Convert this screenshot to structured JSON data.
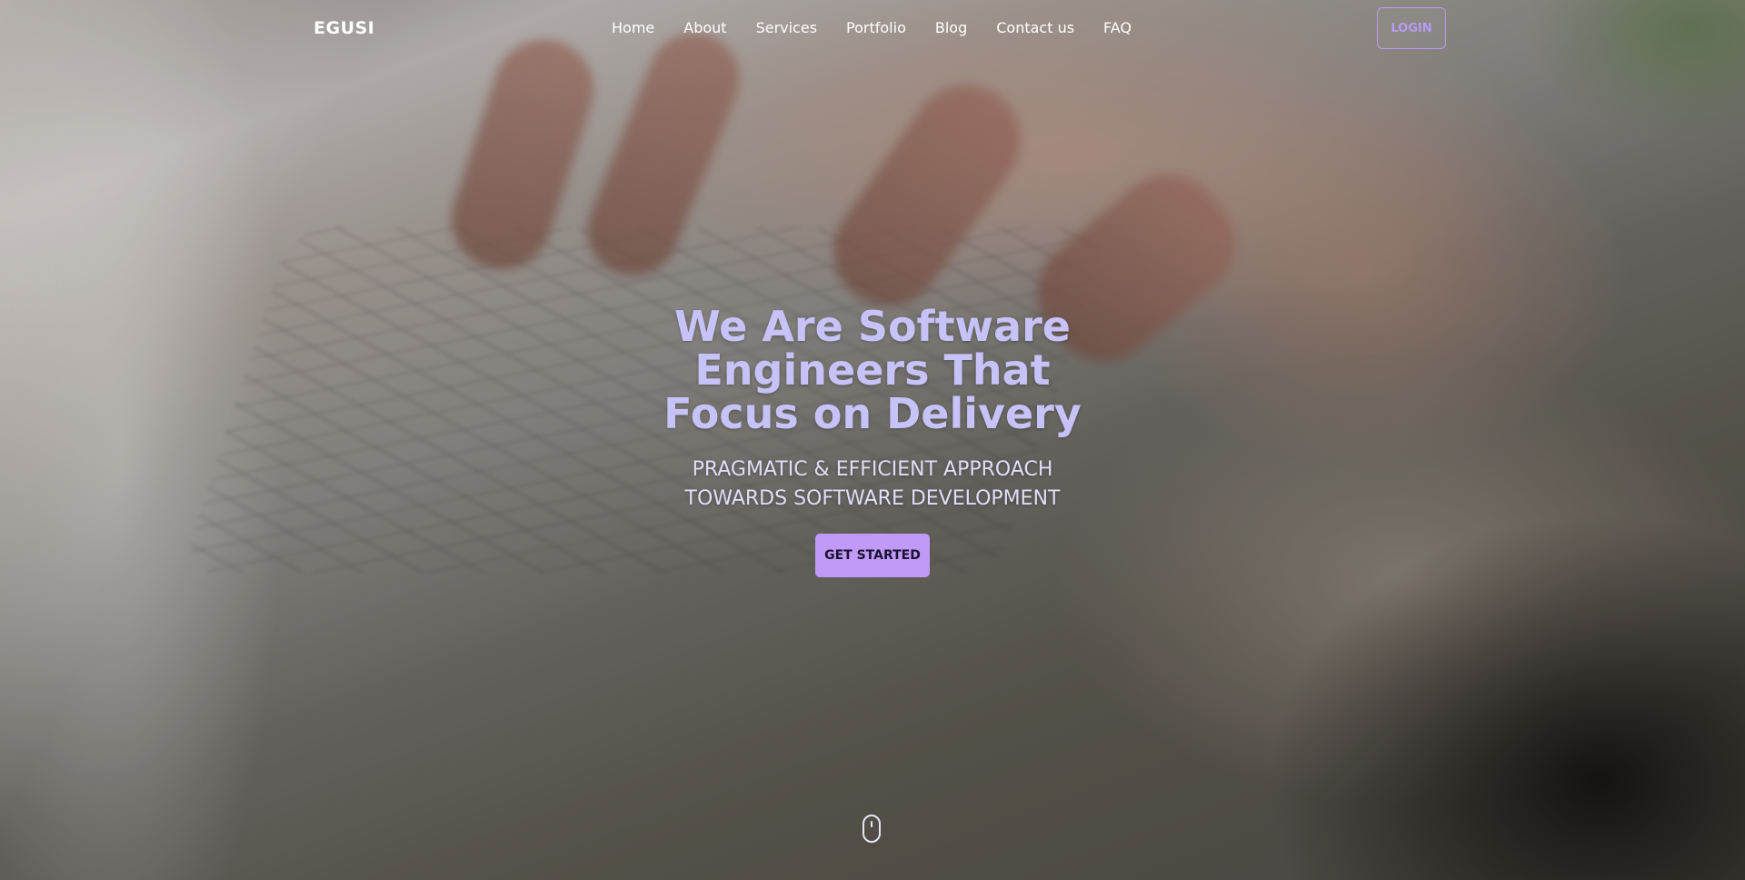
{
  "nav": {
    "brand": "EGUSI",
    "items": [
      "Home",
      "About",
      "Services",
      "Portfolio",
      "Blog",
      "Contact us",
      "FAQ"
    ],
    "login_label": "LOGIN"
  },
  "hero": {
    "headline": "We Are Software Engineers That Focus on Delivery",
    "subheadline_line1": "PRAGMATIC & EFFICIENT APPROACH",
    "subheadline_line2": "TOWARDS SOFTWARE DEVELOPMENT",
    "cta_label": "GET STARTED"
  },
  "icons": {
    "scroll": "mouse-scroll-icon"
  },
  "colors": {
    "accent": "#c09af6",
    "headline": "#c7c3f8",
    "login_border": "#b89cf5"
  }
}
